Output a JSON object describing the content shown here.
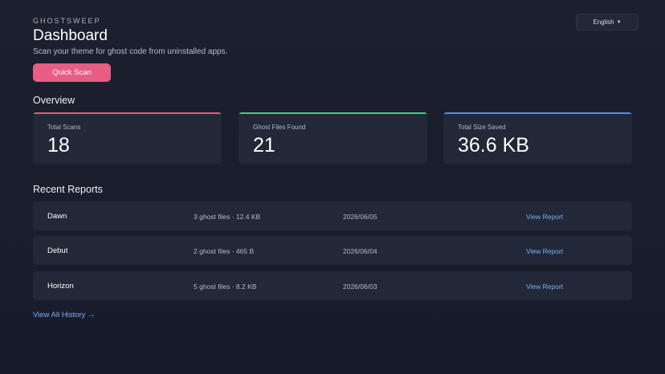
{
  "header": {
    "brand": "GHOSTSWEEP",
    "title": "Dashboard",
    "subtitle": "Scan your theme for ghost code from uninstalled apps.",
    "language": "English",
    "quick_scan_label": "Quick Scan"
  },
  "overview": {
    "title": "Overview",
    "cards": [
      {
        "label": "Total Scans",
        "value": "18",
        "accent": "#e75d83"
      },
      {
        "label": "Ghost Files Found",
        "value": "21",
        "accent": "#3ecf8e"
      },
      {
        "label": "Total Size Saved",
        "value": "36.6 KB",
        "accent": "#5a8fe0"
      }
    ]
  },
  "reports": {
    "title": "Recent Reports",
    "rows": [
      {
        "name": "Dawn",
        "meta": "3 ghost files · 12.4 KB",
        "date": "2026/06/05",
        "action": "View Report"
      },
      {
        "name": "Debut",
        "meta": "2 ghost files · 465 B",
        "date": "2026/06/04",
        "action": "View Report"
      },
      {
        "name": "Horizon",
        "meta": "5 ghost files · 8.2 KB",
        "date": "2026/06/03",
        "action": "View Report"
      }
    ],
    "history_link": "View All History →"
  },
  "icons": {
    "language_caret": "chevron-down-icon"
  }
}
